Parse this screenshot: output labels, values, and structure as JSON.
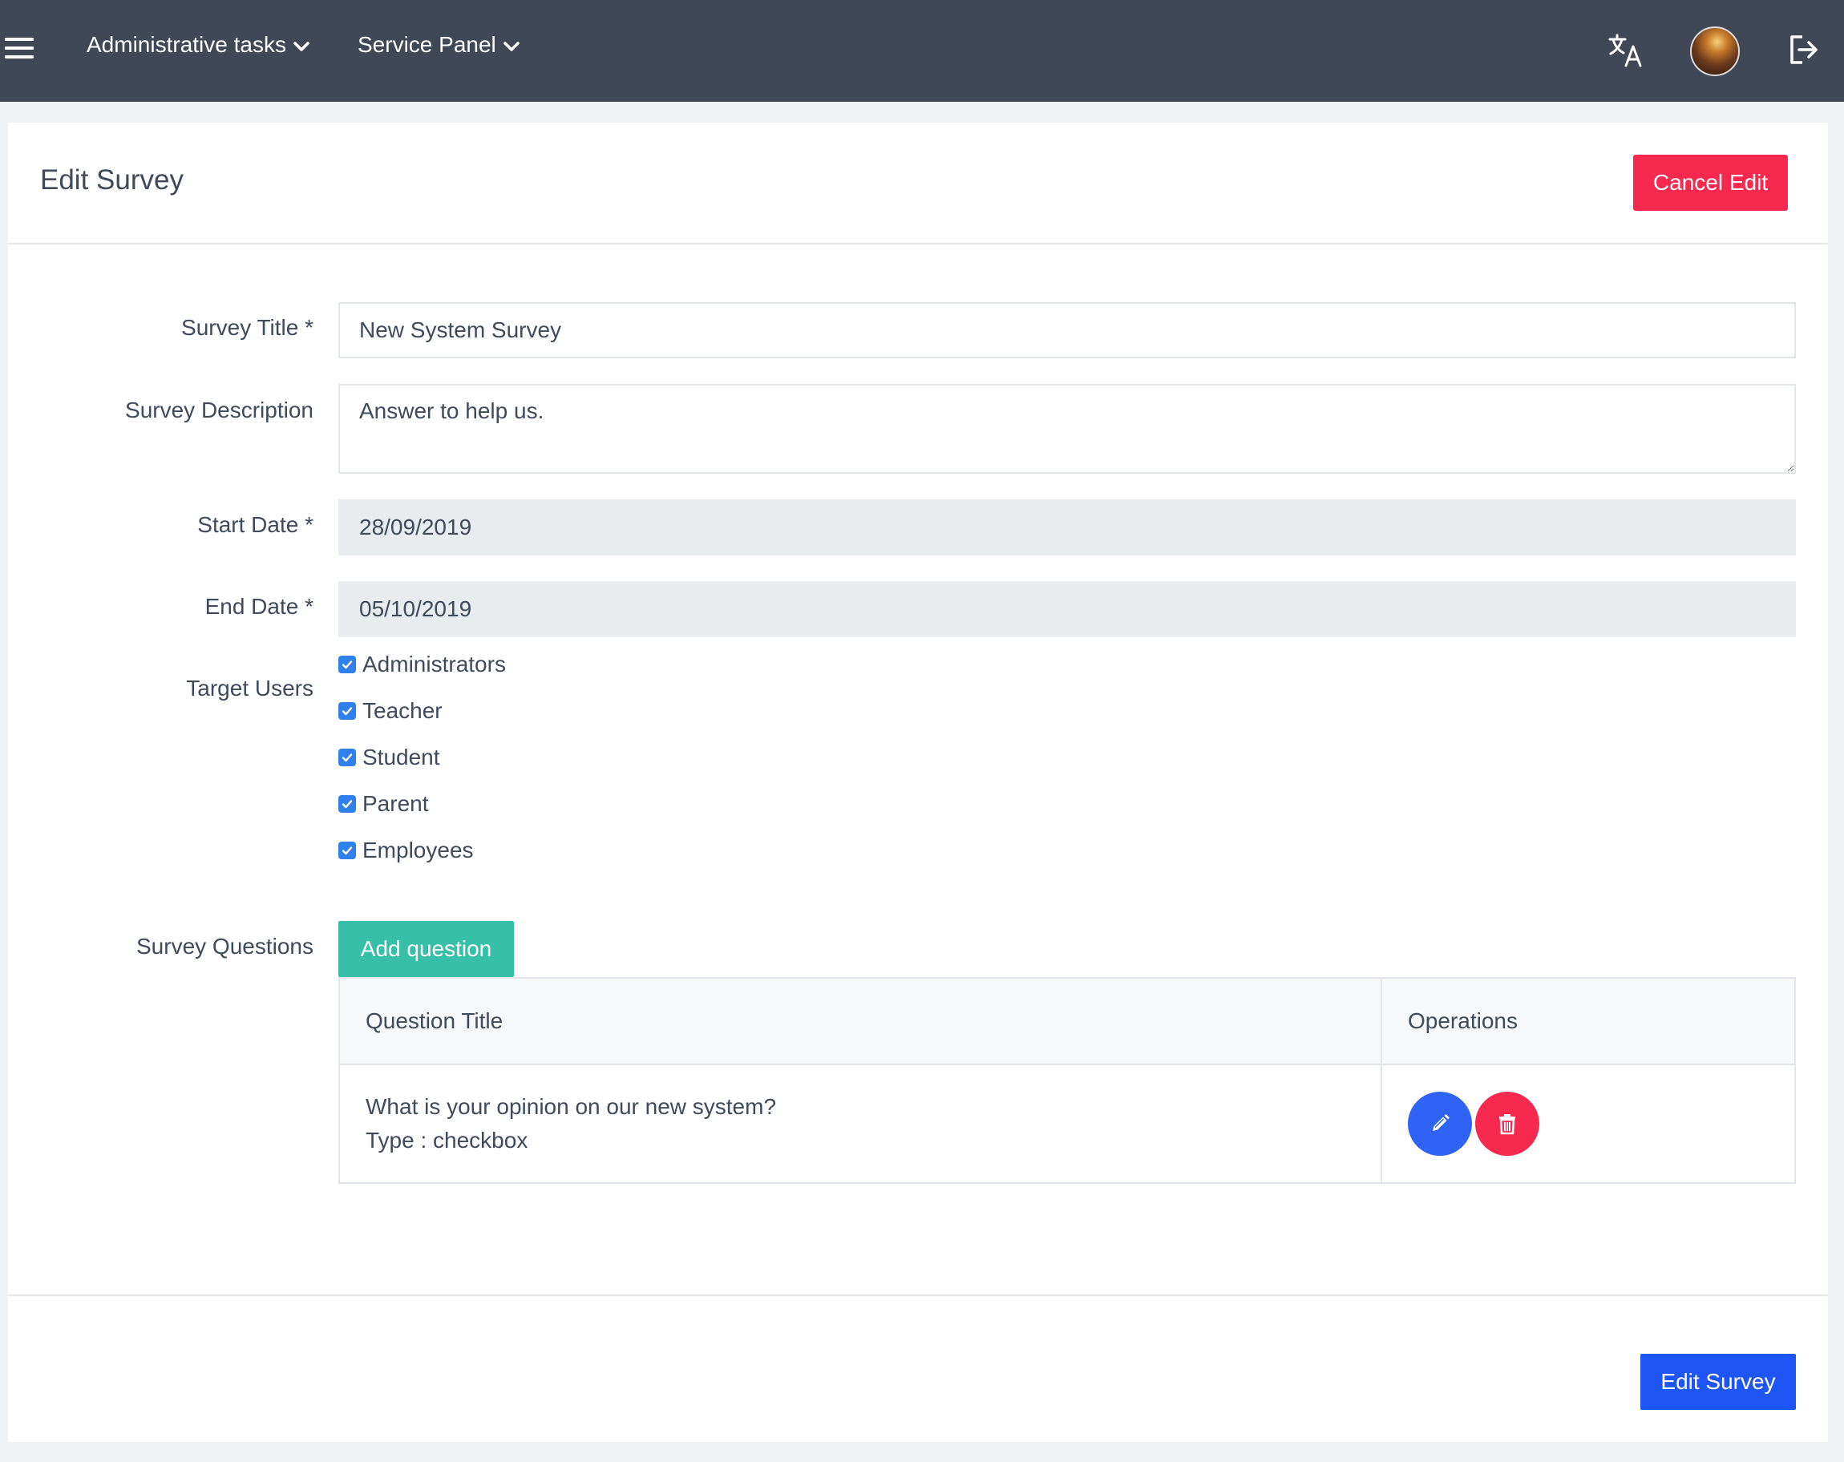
{
  "navbar": {
    "menus": [
      "Administrative tasks",
      "Service Panel"
    ],
    "icons": [
      "hamburger-icon",
      "translate-icon",
      "avatar",
      "logout-icon"
    ]
  },
  "header": {
    "title": "Edit Survey",
    "cancel_label": "Cancel Edit"
  },
  "form": {
    "title_label": "Survey Title *",
    "title_value": "New System Survey",
    "description_label": "Survey Description",
    "description_value": "Answer to help us.",
    "start_label": "Start Date *",
    "start_value": "28/09/2019",
    "end_label": "End Date *",
    "end_value": "05/10/2019",
    "target_label": "Target Users",
    "targets": [
      {
        "label": "Administrators",
        "checked": true
      },
      {
        "label": "Teacher",
        "checked": true
      },
      {
        "label": "Student",
        "checked": true
      },
      {
        "label": "Parent",
        "checked": true
      },
      {
        "label": "Employees",
        "checked": true
      }
    ],
    "questions_label": "Survey Questions",
    "add_question_label": "Add question"
  },
  "questions_table": {
    "headers": [
      "Question Title",
      "Operations"
    ],
    "rows": [
      {
        "title": "What is your opinion on our new system?",
        "type": "Type : checkbox"
      }
    ]
  },
  "footer": {
    "submit_label": "Edit Survey"
  },
  "colors": {
    "navbar": "#414855",
    "danger": "#f8294e",
    "primary": "#1e56f5",
    "success": "#37bfa7",
    "checkbox": "#2f80ed"
  }
}
